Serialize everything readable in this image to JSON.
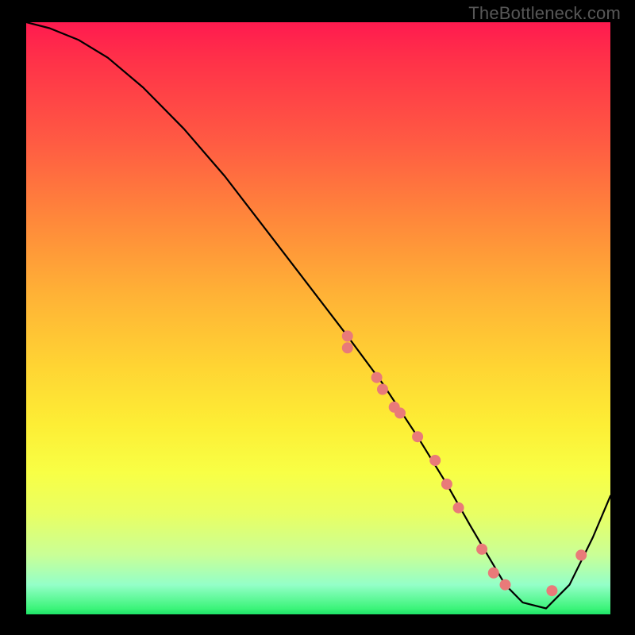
{
  "watermark": "TheBottleneck.com",
  "chart_data": {
    "type": "line",
    "title": "",
    "xlabel": "",
    "ylabel": "",
    "xlim": [
      0,
      100
    ],
    "ylim": [
      0,
      100
    ],
    "grid": false,
    "legend": false,
    "series": [
      {
        "name": "bottleneck-curve",
        "color": "#000000",
        "x": [
          0,
          4,
          9,
          14,
          20,
          27,
          34,
          41,
          48,
          55,
          61,
          67,
          72,
          76,
          79,
          82,
          85,
          89,
          93,
          97,
          100
        ],
        "y": [
          100,
          99,
          97,
          94,
          89,
          82,
          74,
          65,
          56,
          47,
          39,
          30,
          22,
          15,
          10,
          5,
          2,
          1,
          5,
          13,
          20
        ]
      }
    ],
    "markers": {
      "name": "highlight-points",
      "color": "#e97a79",
      "radius_px": 7,
      "x": [
        55,
        55,
        60,
        61,
        63,
        64,
        67,
        70,
        72,
        74,
        78,
        80,
        82,
        90,
        95
      ],
      "y": [
        47,
        45,
        40,
        38,
        35,
        34,
        30,
        26,
        22,
        18,
        11,
        7,
        5,
        4,
        10
      ]
    },
    "background_gradient": {
      "type": "vertical",
      "stops": [
        {
          "pos": 0.0,
          "color": "#ff1a4f"
        },
        {
          "pos": 0.34,
          "color": "#ff8a3a"
        },
        {
          "pos": 0.68,
          "color": "#fdee35"
        },
        {
          "pos": 0.95,
          "color": "#94ffc8"
        },
        {
          "pos": 1.0,
          "color": "#1ee267"
        }
      ]
    }
  }
}
